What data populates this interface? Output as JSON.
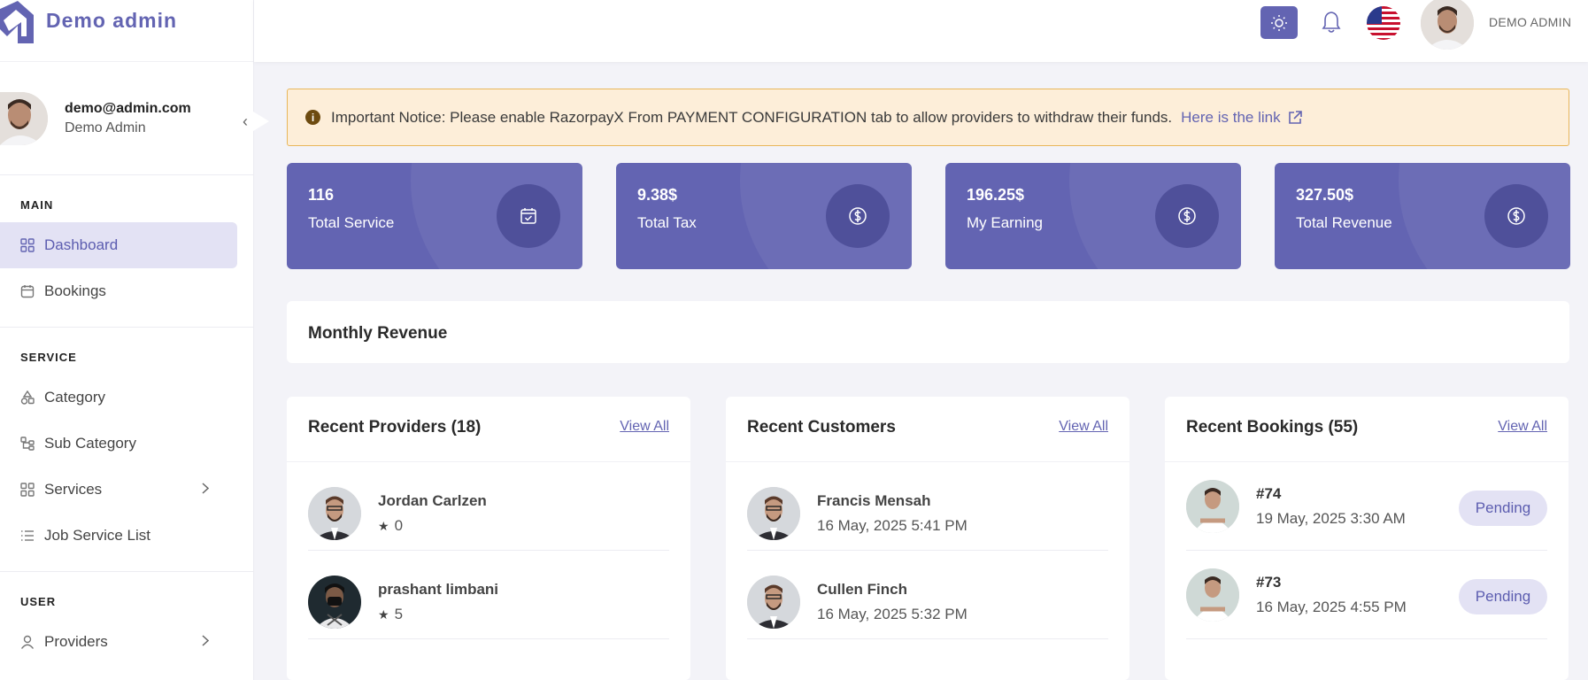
{
  "brand": {
    "name": "Demo admin"
  },
  "profile": {
    "email": "demo@admin.com",
    "name": "Demo Admin"
  },
  "sidebar": {
    "sections": [
      {
        "heading": "MAIN",
        "items": [
          {
            "label": "Dashboard",
            "icon": "grid-icon",
            "active": true
          },
          {
            "label": "Bookings",
            "icon": "calendar-icon"
          }
        ]
      },
      {
        "heading": "SERVICE",
        "items": [
          {
            "label": "Category",
            "icon": "shapes-icon"
          },
          {
            "label": "Sub Category",
            "icon": "sub-category-icon"
          },
          {
            "label": "Services",
            "icon": "grid-icon",
            "chevron": true
          },
          {
            "label": "Job Service List",
            "icon": "list-icon"
          }
        ]
      },
      {
        "heading": "USER",
        "items": [
          {
            "label": "Providers",
            "icon": "user-icon",
            "chevron": true
          }
        ]
      }
    ]
  },
  "topbar": {
    "user": "DEMO ADMIN",
    "accent": "#6364b2"
  },
  "notice": {
    "text": "Important Notice: Please enable RazorpayX From PAYMENT CONFIGURATION tab to allow providers to withdraw their funds.",
    "link": "Here is the link"
  },
  "stats": [
    {
      "value": "116",
      "label": "Total Service",
      "icon": "calendar-check-icon"
    },
    {
      "value": "9.38$",
      "label": "Total Tax",
      "icon": "dollar-circle-icon"
    },
    {
      "value": "196.25$",
      "label": "My Earning",
      "icon": "dollar-circle-icon"
    },
    {
      "value": "327.50$",
      "label": "Total Revenue",
      "icon": "dollar-circle-icon"
    }
  ],
  "monthly": {
    "title": "Monthly Revenue"
  },
  "providers": {
    "title": "Recent Providers (18)",
    "view_all": "View All",
    "rows": [
      {
        "name": "Jordan Carlzen",
        "rating": "0"
      },
      {
        "name": "prashant limbani",
        "rating": "5"
      }
    ]
  },
  "customers": {
    "title": "Recent Customers",
    "view_all": "View All",
    "rows": [
      {
        "name": "Francis Mensah",
        "date": "16 May, 2025 5:41 PM"
      },
      {
        "name": "Cullen Finch",
        "date": "16 May, 2025 5:32 PM"
      }
    ]
  },
  "bookings": {
    "title": "Recent Bookings (55)",
    "view_all": "View All",
    "rows": [
      {
        "id": "#74",
        "date": "19 May, 2025 3:30 AM",
        "status": "Pending"
      },
      {
        "id": "#73",
        "date": "16 May, 2025 4:55 PM",
        "status": "Pending"
      }
    ]
  }
}
